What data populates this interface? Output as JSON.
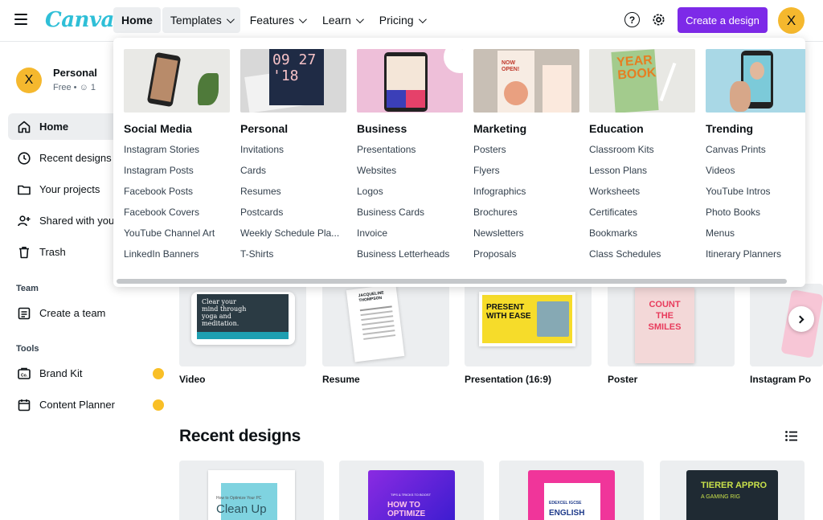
{
  "header": {
    "logo": "Canva",
    "nav": [
      {
        "label": "Home"
      },
      {
        "label": "Templates"
      },
      {
        "label": "Features"
      },
      {
        "label": "Learn"
      },
      {
        "label": "Pricing"
      }
    ],
    "help_glyph": "?",
    "create_button": "Create a design",
    "avatar_letter": "X"
  },
  "sidebar": {
    "profile": {
      "avatar_letter": "X",
      "name": "Personal",
      "plan": "Free",
      "members": "1"
    },
    "items": [
      {
        "label": "Home",
        "icon": "home-icon"
      },
      {
        "label": "Recent designs",
        "icon": "clock-icon"
      },
      {
        "label": "Your projects",
        "icon": "folder-icon"
      },
      {
        "label": "Shared with you",
        "icon": "share-icon"
      },
      {
        "label": "Trash",
        "icon": "trash-icon"
      }
    ],
    "team_section": "Team",
    "team_items": [
      {
        "label": "Create a team",
        "icon": "team-icon"
      }
    ],
    "tools_section": "Tools",
    "tools_items": [
      {
        "label": "Brand Kit",
        "icon": "brand-kit-icon"
      },
      {
        "label": "Content Planner",
        "icon": "calendar-icon"
      }
    ]
  },
  "templates_menu": {
    "columns": [
      {
        "heading": "Social Media",
        "links": [
          "Instagram Stories",
          "Instagram Posts",
          "Facebook Posts",
          "Facebook Covers",
          "YouTube Channel Art",
          "LinkedIn Banners"
        ],
        "thumb_text": ""
      },
      {
        "heading": "Personal",
        "links": [
          "Invitations",
          "Cards",
          "Resumes",
          "Postcards",
          "Weekly Schedule Pla...",
          "T-Shirts"
        ],
        "thumb_text": "09 27 '18"
      },
      {
        "heading": "Business",
        "links": [
          "Presentations",
          "Websites",
          "Logos",
          "Business Cards",
          "Invoice",
          "Business Letterheads"
        ],
        "thumb_text": ""
      },
      {
        "heading": "Marketing",
        "links": [
          "Posters",
          "Flyers",
          "Infographics",
          "Brochures",
          "Newsletters",
          "Proposals"
        ],
        "thumb_text": "NOW OPEN!"
      },
      {
        "heading": "Education",
        "links": [
          "Classroom Kits",
          "Lesson Plans",
          "Worksheets",
          "Certificates",
          "Bookmarks",
          "Class Schedules"
        ],
        "thumb_text": "YEAR BOOK"
      },
      {
        "heading": "Trending",
        "links": [
          "Canvas Prints",
          "Videos",
          "YouTube Intros",
          "Photo Books",
          "Menus",
          "Itinerary Planners"
        ],
        "thumb_text": ""
      }
    ]
  },
  "design_types": [
    {
      "label": "Video",
      "thumb_text": "Clear your mind through yoga and meditation."
    },
    {
      "label": "Resume",
      "thumb_text": "JACQUELINE THOMPSON"
    },
    {
      "label": "Presentation (16:9)",
      "thumb_text": "PRESENT WITH EASE"
    },
    {
      "label": "Poster",
      "thumb_text": "COUNT THE SMILES"
    },
    {
      "label": "Instagram Po",
      "thumb_text": ""
    }
  ],
  "recent": {
    "title": "Recent designs",
    "items": [
      {
        "thumb_text": "Clean Up",
        "sub_text": "How to Optimize Your PC"
      },
      {
        "thumb_text": "HOW TO OPTIMIZE",
        "sub_text": "TIPS & TRICKS TO BOOST"
      },
      {
        "thumb_text": "ENGLISH",
        "sub_text": "EDEXCEL IGCSE"
      },
      {
        "thumb_text": "TIERER APPRO",
        "sub_text": "A GAMING RIG"
      }
    ]
  },
  "colors": {
    "brand": "#7d2ae8",
    "logo": "#2fbfd7",
    "avatar": "#f5b82e",
    "crown": "#f9bf26"
  }
}
